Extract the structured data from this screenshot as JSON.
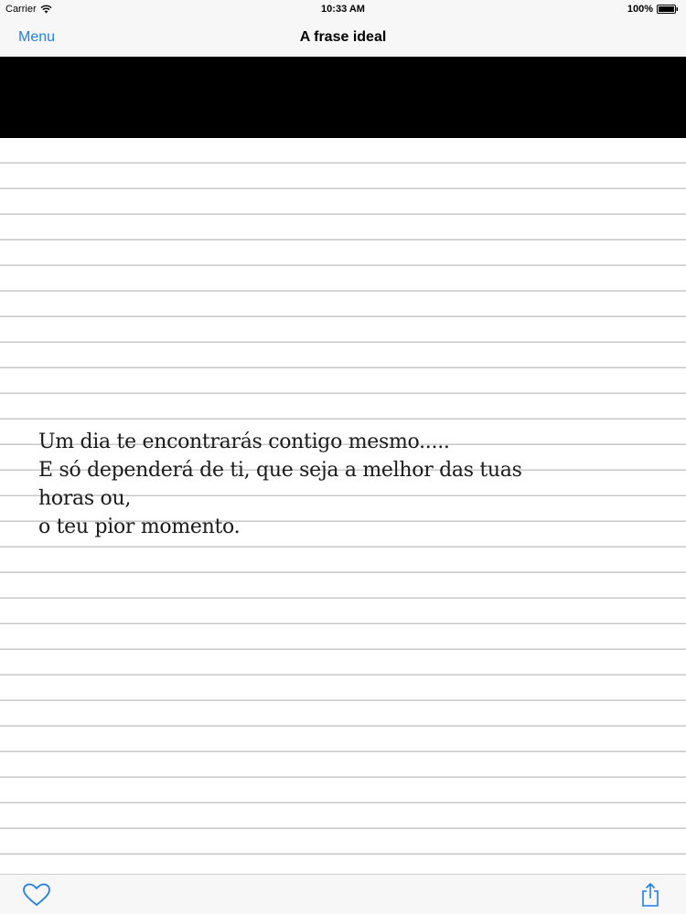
{
  "status_bar": {
    "carrier": "Carrier",
    "time": "10:33 AM",
    "battery": "100%",
    "icons": [
      "wifi-icon",
      "battery-icon"
    ]
  },
  "nav_bar": {
    "menu_label": "Menu",
    "title": "A frase ideal"
  },
  "quote": {
    "lines": [
      "Um dia te encontrarás contigo mesmo.....",
      "E só dependerá de ti, que seja a melhor das tuas",
      "horas ou,",
      "o teu pior momento."
    ]
  },
  "toolbar": {
    "icons": [
      "heart-icon",
      "share-icon"
    ]
  },
  "colors": {
    "accent": "#1a7ff0",
    "banner": "#000000",
    "paper_line": "#c8c8c8",
    "bar_background": "#f7f7f7"
  }
}
